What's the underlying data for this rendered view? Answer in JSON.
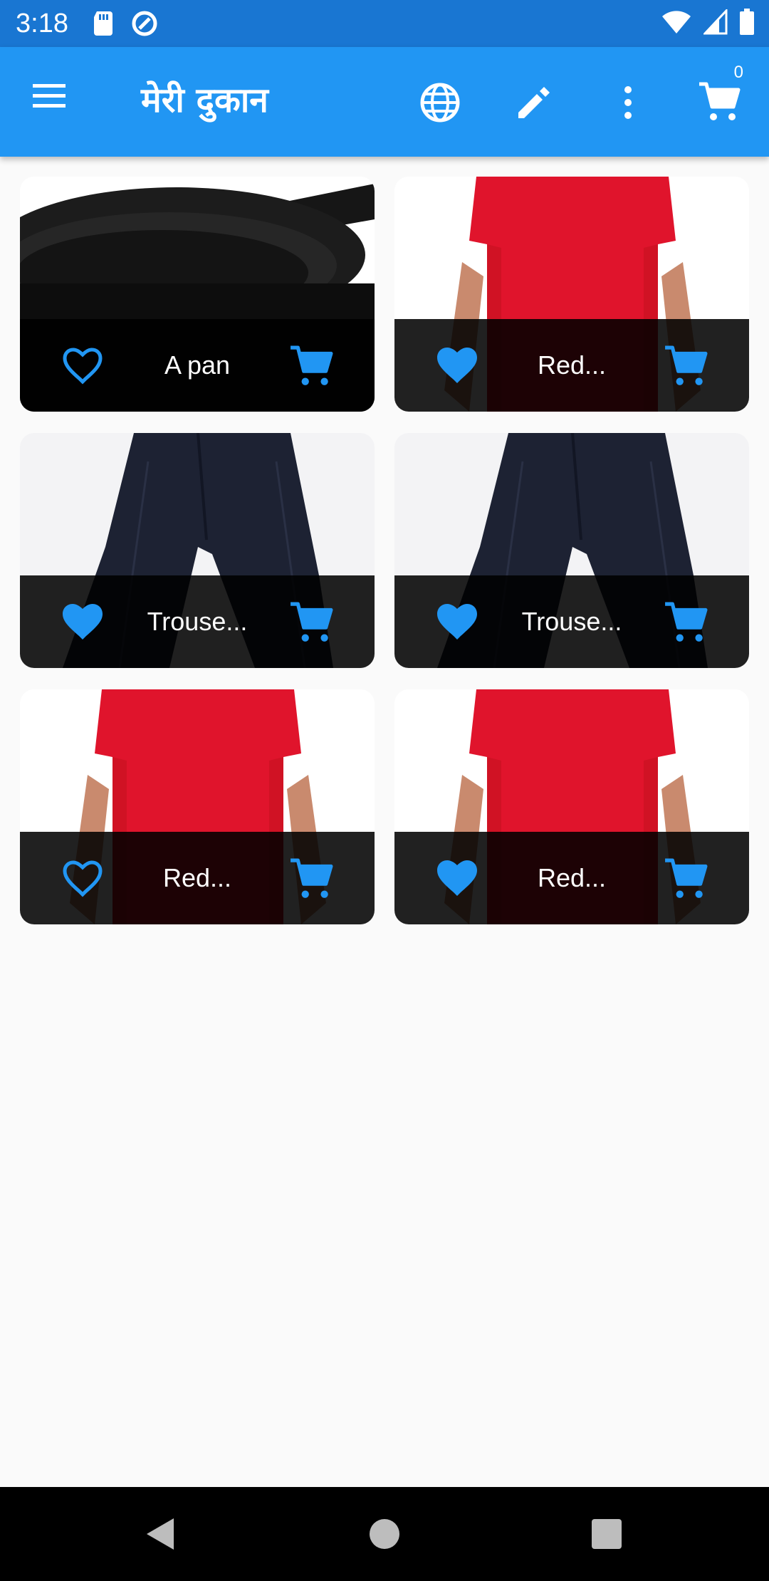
{
  "status_bar": {
    "time": "3:18",
    "icons": [
      "sd-card-icon",
      "sync-icon",
      "wifi-icon",
      "signal-icon",
      "battery-icon"
    ]
  },
  "app_bar": {
    "title": "मेरी दुकान",
    "actions": [
      "menu-icon",
      "language-icon",
      "edit-icon",
      "more-vert-icon",
      "cart-icon"
    ],
    "cart_count": "0"
  },
  "products": [
    {
      "title": "A pan",
      "image": "frying-pan",
      "favorite": false
    },
    {
      "title": "Red...",
      "image": "red-shirt",
      "favorite": true
    },
    {
      "title": "Trouse...",
      "image": "trousers",
      "favorite": true
    },
    {
      "title": "Trouse...",
      "image": "trousers",
      "favorite": true
    },
    {
      "title": "Red...",
      "image": "red-shirt",
      "favorite": false
    },
    {
      "title": "Red...",
      "image": "red-shirt",
      "favorite": true
    }
  ],
  "colors": {
    "status_bar": "#1976d2",
    "app_bar": "#2196f3",
    "accent": "#2196f3",
    "card_footer": "rgba(0,0,0,0.87)"
  },
  "nav_bar": {
    "buttons": [
      "back-icon",
      "home-icon",
      "recents-icon"
    ]
  }
}
